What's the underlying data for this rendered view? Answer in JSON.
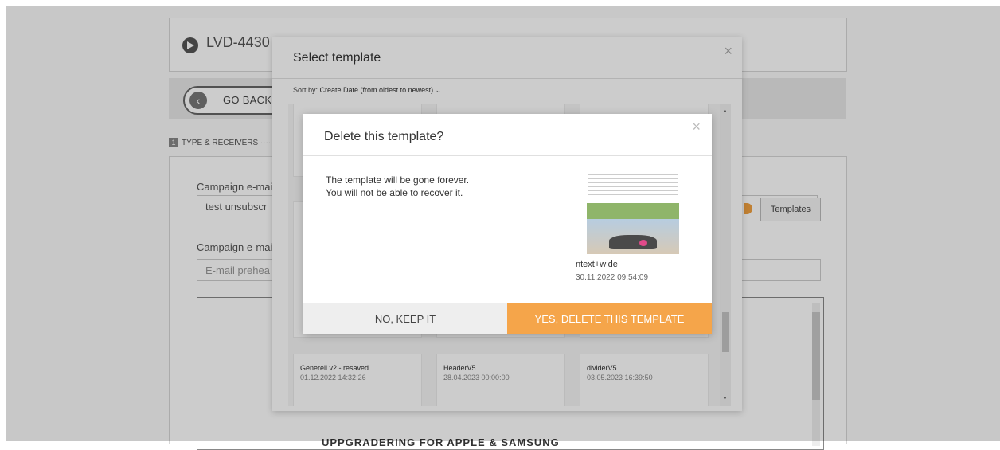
{
  "page": {
    "campaign_title": "LVD-4430",
    "go_back_label": "GO BACK",
    "step_number": "1",
    "step_label": "TYPE & RECEIVERS ····",
    "subject_label": "Campaign e-mai",
    "subject_value": "test unsubscr",
    "templates_button": "Templates",
    "preheader_label": "Campaign e-mai",
    "preheader_placeholder": "E-mail prehea",
    "editor_heading": "UPPGRADERING FOR APPLE & SAMSUNG"
  },
  "select_modal": {
    "title": "Select template",
    "sort_prefix": "Sort by:",
    "sort_value": "Create Date (from oldest to newest)",
    "sort_chevron": "⌄",
    "close": "×",
    "templates": [
      {
        "name": "Generell v2 - resaved",
        "date": "01.12.2022 14:32:26"
      },
      {
        "name": "HeaderV5",
        "date": "28.04.2023 00:00:00"
      },
      {
        "name": "dividerV5",
        "date": "03.05.2023 16:39:50"
      }
    ],
    "scroll_up": "▲",
    "scroll_down": "▼"
  },
  "delete_dialog": {
    "title": "Delete this template?",
    "close": "×",
    "message_line1": "The template will be gone forever.",
    "message_line2": "You will not be able to recover it.",
    "template_name": "ntext+wide",
    "template_date": "30.11.2022 09:54:09",
    "cancel_label": "NO, KEEP IT",
    "confirm_label": "YES, DELETE THIS TEMPLATE"
  },
  "colors": {
    "confirm": "#f5a54a",
    "cancel": "#eeeeee"
  }
}
